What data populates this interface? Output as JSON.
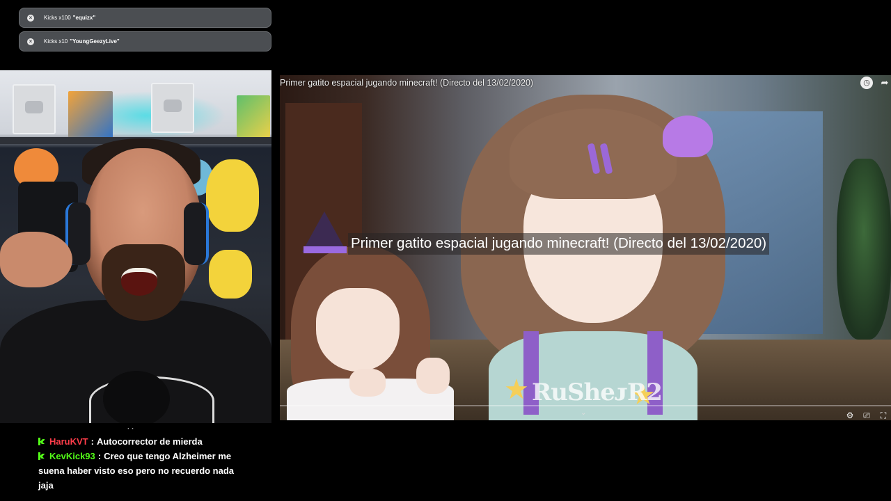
{
  "alerts": [
    {
      "prefix": "Kicks x100",
      "user": "\"equizx\""
    },
    {
      "prefix": "Kicks x10",
      "user": "\"YoungGeezyLive\""
    }
  ],
  "player": {
    "title": "Primer gatito espacial jugando minecraft! (Directo del 13/02/2020)",
    "overlay_title": "Primer gatito espacial jugando minecraft! (Directo del 13/02/2020)",
    "watermark": "RuSheᴊR2",
    "progress_fraction": 0.0,
    "icons": {
      "watch_later": "clock-icon",
      "share": "share-icon",
      "settings": "gear-icon",
      "cast": "cast-icon",
      "fullscreen": "fullscreen-icon",
      "expand": "chevron-down-icon"
    }
  },
  "chat": {
    "dots": "· ·",
    "messages": [
      {
        "user": "HaruKVT",
        "user_color": "#ff3d4a",
        "text": "Autocorrector de mierda"
      },
      {
        "user": "KevKick93",
        "user_color": "#53fc18",
        "text": "Creo que tengo Alzheimer me suena haber visto eso pero no recuerdo nada jaja"
      }
    ]
  },
  "colors": {
    "kick_green": "#53fc18",
    "alert_bg": "#4b4e52",
    "progress": "#ff0000"
  }
}
